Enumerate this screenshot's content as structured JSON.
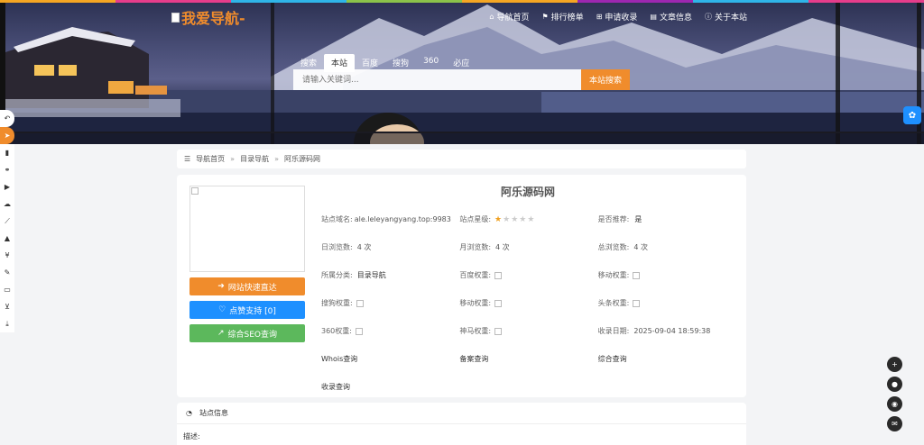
{
  "colors": {
    "accent": "#f08c2c",
    "blue": "#1e90ff",
    "green": "#5cb85c",
    "star": "#f0a020"
  },
  "logo": {
    "text": "我爱导航-"
  },
  "topnav": [
    {
      "icon": "home-icon",
      "label": "导航首页"
    },
    {
      "icon": "flag-icon",
      "label": "排行榜单"
    },
    {
      "icon": "plus-square-icon",
      "label": "申请收录"
    },
    {
      "icon": "book-icon",
      "label": "文章信息"
    },
    {
      "icon": "info-circle-icon",
      "label": "关于本站"
    }
  ],
  "search": {
    "tabs": [
      "搜索",
      "本站",
      "百度",
      "搜狗",
      "360",
      "必应"
    ],
    "active_tab": "本站",
    "placeholder": "请输入关键词...",
    "button": "本站搜索"
  },
  "breadcrumb": {
    "home": "导航首页",
    "sep": "»",
    "category": "目录导航",
    "current": "阿乐源码网"
  },
  "site": {
    "title": "阿乐源码网",
    "buttons": {
      "fast": "网站快速直达",
      "like": "点赞支持 [0]",
      "seo": "综合SEO查询"
    },
    "rating": 1,
    "rating_max": 5,
    "fields": {
      "domain_label": "站点域名:",
      "domain": "ale.leleyangyang.top:9983",
      "star_label": "站点星级:",
      "recommend_label": "是否推荐:",
      "recommend": "是",
      "daily_label": "日浏览数:",
      "daily": "4 次",
      "monthly_label": "月浏览数:",
      "monthly": "4 次",
      "total_label": "总浏览数:",
      "total": "4 次",
      "category_label": "所属分类:",
      "category": "目录导航",
      "baidu_label": "百度权重:",
      "mobile_label": "移动权重:",
      "sogou_label": "搜狗权重:",
      "mobile2_label": "移动权重:",
      "toutiao_label": "头条权重:",
      "s360_label": "360权重:",
      "shenma_label": "神马权重:",
      "date_label": "收录日期:",
      "date": "2025-09-04 18:59:38"
    },
    "links": {
      "whois": "Whois查询",
      "beian": "备案查询",
      "general": "综合查询",
      "shoulu": "收录查询"
    }
  },
  "section": {
    "title": "站点信息",
    "desc_label": "描述:"
  }
}
